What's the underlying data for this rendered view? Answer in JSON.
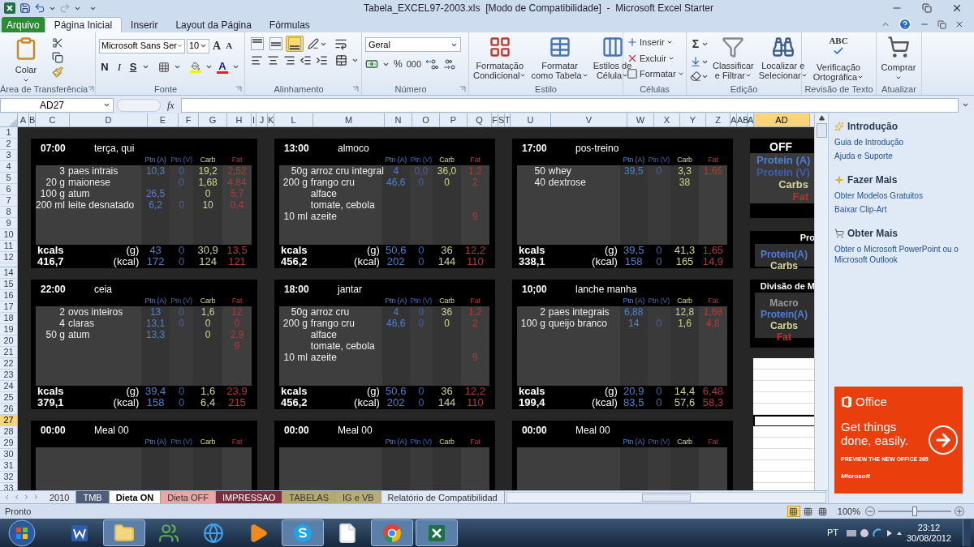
{
  "window": {
    "title": "Tabela_EXCEL97-2003.xls  [Modo de Compatibilidade]  -  Microsoft Excel Starter"
  },
  "ribbon_tabs": [
    {
      "label": "Arquivo",
      "kind": "file",
      "selected": false
    },
    {
      "label": "Página Inicial",
      "kind": "tab",
      "selected": true
    },
    {
      "label": "Inserir",
      "kind": "tab",
      "selected": false
    },
    {
      "label": "Layout da Página",
      "kind": "tab",
      "selected": false
    },
    {
      "label": "Fórmulas",
      "kind": "tab",
      "selected": false
    }
  ],
  "ribbon": {
    "clipboard": {
      "title": "Área de Transferência",
      "paste": "Colar"
    },
    "font": {
      "title": "Fonte",
      "font_name": "Microsoft Sans Ser",
      "font_size": "10",
      "grow": "A",
      "shrink": "A",
      "bold": "N",
      "italic": "I",
      "underline": "S",
      "color_letter": "A"
    },
    "alignment": {
      "title": "Alinhamento",
      "vertical": [
        {
          "selected": false
        },
        {
          "selected": false
        },
        {
          "selected": true
        }
      ]
    },
    "number": {
      "title": "Número",
      "format": "Geral",
      "percent": "%",
      "thousands": "000"
    },
    "styles": {
      "title": "Estilo",
      "buttons": [
        {
          "lines": [
            "Formatação",
            "Condicional"
          ]
        },
        {
          "lines": [
            "Formatar",
            "como Tabela"
          ]
        },
        {
          "lines": [
            "Estilos de",
            "Célula"
          ]
        }
      ]
    },
    "cells": {
      "title": "Células",
      "buttons": [
        "Inserir",
        "Excluir",
        "Formatar"
      ]
    },
    "editing": {
      "title": "Edição",
      "sum": "Σ",
      "buttons": [
        {
          "lines": [
            "Classificar",
            "e Filtrar"
          ]
        },
        {
          "lines": [
            "Localizar e",
            "Selecionar"
          ]
        }
      ]
    },
    "proofing": {
      "title": "Revisão de Texto",
      "icon_text": "ABC",
      "lines": [
        "Verificação",
        "Ortográfica"
      ]
    },
    "update": {
      "title": "Atualizar",
      "label": "Comprar"
    }
  },
  "formula_bar": {
    "name_box": "AD27",
    "fx": "fx"
  },
  "columns": [
    {
      "label": "A",
      "selected": false
    },
    {
      "label": "B",
      "selected": false
    },
    {
      "label": "C",
      "selected": false
    },
    {
      "label": "D",
      "selected": false
    },
    {
      "label": "E",
      "selected": false
    },
    {
      "label": "F",
      "selected": false
    },
    {
      "label": "G",
      "selected": false
    },
    {
      "label": "H",
      "selected": false
    },
    {
      "label": "I",
      "selected": false
    },
    {
      "label": "J",
      "selected": false
    },
    {
      "label": "K",
      "selected": false
    },
    {
      "label": "L",
      "selected": false
    },
    {
      "label": "M",
      "selected": false
    },
    {
      "label": "N",
      "selected": false
    },
    {
      "label": "O",
      "selected": false
    },
    {
      "label": "P",
      "selected": false
    },
    {
      "label": "Q",
      "selected": false
    },
    {
      "label": "F",
      "selected": false
    },
    {
      "label": "S",
      "selected": false
    },
    {
      "label": "T",
      "selected": false
    },
    {
      "label": "U",
      "selected": false
    },
    {
      "label": "V",
      "selected": false
    },
    {
      "label": "W",
      "selected": false
    },
    {
      "label": "X",
      "selected": false
    },
    {
      "label": "Y",
      "selected": false
    },
    {
      "label": "Z",
      "selected": false
    },
    {
      "label": "A",
      "selected": false
    },
    {
      "label": "AB",
      "selected": false
    },
    {
      "label": "A",
      "selected": false
    },
    {
      "label": "AD",
      "selected": true
    }
  ],
  "rows": [
    {
      "label": "1",
      "selected": false
    },
    {
      "label": "2",
      "selected": false
    },
    {
      "label": "3",
      "selected": false
    },
    {
      "label": "4",
      "selected": false
    },
    {
      "label": "5",
      "selected": false
    },
    {
      "label": "6",
      "selected": false
    },
    {
      "label": "7",
      "selected": false
    },
    {
      "label": "8",
      "selected": false
    },
    {
      "label": "9",
      "selected": false
    },
    {
      "label": "10",
      "selected": false
    },
    {
      "label": "11",
      "selected": false
    },
    {
      "label": "12",
      "selected": false
    },
    {
      "label": "14",
      "selected": false
    },
    {
      "label": "15",
      "selected": false
    },
    {
      "label": "16",
      "selected": false
    },
    {
      "label": "17",
      "selected": false
    },
    {
      "label": "18",
      "selected": false
    },
    {
      "label": "19",
      "selected": false
    },
    {
      "label": "20",
      "selected": false
    },
    {
      "label": "21",
      "selected": false
    },
    {
      "label": "22",
      "selected": false
    },
    {
      "label": "23",
      "selected": false
    },
    {
      "label": "24",
      "selected": false
    },
    {
      "label": "25",
      "selected": false
    },
    {
      "label": "26",
      "selected": false
    },
    {
      "label": "27",
      "selected": true
    },
    {
      "label": "28",
      "selected": false
    },
    {
      "label": "29",
      "selected": false
    },
    {
      "label": "30",
      "selected": false
    },
    {
      "label": "31",
      "selected": false
    },
    {
      "label": "32",
      "selected": false
    },
    {
      "label": "33",
      "selected": false
    }
  ],
  "meal_cards": [
    {
      "time": "07:00",
      "name": "terça, qui",
      "headers": [
        "Ptn (A)",
        "Ptn (V)",
        "Carb",
        "Fat"
      ],
      "items": [
        {
          "qty": "3",
          "name": "paes intrais",
          "ptn_a": "10,3",
          "ptn_v": "0",
          "carb": "19,2",
          "fat": "2,52"
        },
        {
          "qty": "20 g",
          "name": "maionese",
          "ptn_v": "0",
          "carb": "1,68",
          "fat": "4,84"
        },
        {
          "qty": "100 g",
          "name": "atum",
          "ptn_a": "26,5",
          "carb": "0",
          "fat": "5,7"
        },
        {
          "qty": "200 ml",
          "name": "leite desnatado",
          "ptn_a": "6,2",
          "ptn_v": "0",
          "carb": "10",
          "fat": "0,4"
        }
      ],
      "totals": {
        "label": "kcals",
        "unit_g": "(g)",
        "grams": [
          "43",
          "0",
          "30,9",
          "13,5"
        ],
        "kcal": "416,7",
        "unit_kcal": "(kcal)",
        "kcals": [
          "172",
          "0",
          "124",
          "121"
        ]
      }
    },
    {
      "time": "13:00",
      "name": "almoco",
      "headers": [
        "Ptn (A)",
        "Ptn (V)",
        "Carb",
        "Fat"
      ],
      "items": [
        {
          "qty": "50g",
          "name": "arroz cru integral",
          "ptn_a": "4",
          "ptn_v": "0,0",
          "carb": "36,0",
          "fat": "1,2"
        },
        {
          "qty": "200 g",
          "name": "frango cru",
          "ptn_a": "46,6",
          "ptn_v": "0",
          "carb": "0",
          "fat": "2"
        },
        {
          "name": "alface"
        },
        {
          "name": "tomate, cebola"
        },
        {
          "qty": "10 ml",
          "name": "azeite",
          "fat": "9"
        }
      ],
      "totals": {
        "label": "kcals",
        "unit_g": "(g)",
        "grams": [
          "50,6",
          "0",
          "36",
          "12,2"
        ],
        "kcal": "456,2",
        "unit_kcal": "(kcal)",
        "kcals": [
          "202",
          "0",
          "144",
          "110"
        ]
      }
    },
    {
      "time": "17:00",
      "name": "pos-treino",
      "headers": [
        "Ptn (A)",
        "Ptn (V)",
        "Carb",
        "Fat"
      ],
      "items": [
        {
          "qty": "50",
          "name": "whey",
          "ptn_a": "39,5",
          "ptn_v": "0",
          "carb": "3,3",
          "fat": "1,65"
        },
        {
          "qty": "40",
          "name": "dextrose",
          "carb": "38"
        }
      ],
      "totals": {
        "label": "kcals",
        "unit_g": "(g)",
        "grams": [
          "39,5",
          "0",
          "41,3",
          "1,65"
        ],
        "kcal": "338,1",
        "unit_kcal": "(kcal)",
        "kcals": [
          "158",
          "0",
          "165",
          "14,9"
        ]
      }
    },
    {
      "time": "22:00",
      "name": "ceia",
      "headers": [
        "Ptn (A)",
        "Ptn (V)",
        "Carb",
        "Fat"
      ],
      "items": [
        {
          "qty": "2",
          "name": "ovos inteiros",
          "ptn_a": "13",
          "ptn_v": "0",
          "carb": "1,6",
          "fat": "12"
        },
        {
          "qty": "4",
          "name": "claras",
          "ptn_a": "13,1",
          "ptn_v": "0",
          "carb": "0",
          "fat": "0"
        },
        {
          "qty": "50 g",
          "name": "atum",
          "ptn_a": "13,3",
          "carb": "0",
          "fat": "2,9"
        },
        {
          "fat": "9"
        }
      ],
      "totals": {
        "label": "kcals",
        "unit_g": "(g)",
        "grams": [
          "39,4",
          "0",
          "1,6",
          "23,9"
        ],
        "kcal": "379,1",
        "unit_kcal": "(kcal)",
        "kcals": [
          "158",
          "0",
          "6,4",
          "215"
        ]
      }
    },
    {
      "time": "18:00",
      "name": "jantar",
      "headers": [
        "Ptn (A)",
        "Ptn (V)",
        "Carb",
        "Fat"
      ],
      "items": [
        {
          "qty": "50g",
          "name": "arroz cru",
          "ptn_a": "4",
          "ptn_v": "0",
          "carb": "36",
          "fat": "1,2"
        },
        {
          "qty": "200 g",
          "name": "frango cru",
          "ptn_a": "46,6",
          "ptn_v": "0",
          "carb": "0",
          "fat": "2"
        },
        {
          "name": "alface"
        },
        {
          "name": "tomate, cebola"
        },
        {
          "qty": "10 ml",
          "name": "azeite",
          "fat": "9"
        }
      ],
      "totals": {
        "label": "kcals",
        "unit_g": "(g)",
        "grams": [
          "50,6",
          "0",
          "36",
          "12,2"
        ],
        "kcal": "456,2",
        "unit_kcal": "(kcal)",
        "kcals": [
          "202",
          "0",
          "144",
          "110"
        ]
      }
    },
    {
      "time": "10;00",
      "name": "lanche manha",
      "headers": [
        "Ptn (A)",
        "Ptn (V)",
        "Carb",
        "Fat"
      ],
      "items": [
        {
          "qty": "2",
          "name": "paes integrais",
          "ptn_a": "6,88",
          "carb": "12,8",
          "fat": "1,68"
        },
        {
          "qty": "100 g",
          "name": "queijo branco",
          "ptn_a": "14",
          "ptn_v": "0",
          "carb": "1,6",
          "fat": "4,8"
        }
      ],
      "totals": {
        "label": "kcals",
        "unit_g": "(g)",
        "grams": [
          "20,9",
          "0",
          "14,4",
          "6,48"
        ],
        "kcal": "199,4",
        "unit_kcal": "(kcal)",
        "kcals": [
          "83,5",
          "0",
          "57,6",
          "58,3"
        ]
      }
    },
    {
      "time": "00:00",
      "name": "Meal 00",
      "headers": [
        "Ptn (A)",
        "Ptn (V)",
        "Carb",
        "Fat"
      ]
    },
    {
      "time": "00:00",
      "name": "Meal 00",
      "headers": [
        "Ptn (A)",
        "Ptn (V)",
        "Carb",
        "Fat"
      ]
    },
    {
      "time": "00:00",
      "name": "Meal 00",
      "headers": [
        "Ptn (A)",
        "Ptn (V)",
        "Carb",
        "Fat"
      ]
    }
  ],
  "side_panels": [
    {
      "kind": "summary",
      "title": "OFF",
      "lines": [
        {
          "text": "Protein (A)",
          "color": "#4f7fd6"
        },
        {
          "text": "Protein (V)",
          "color": "#3f5fae"
        },
        {
          "text": "Carbs",
          "color": "#d2d69a"
        },
        {
          "text": "Fat",
          "color": "#c0302a"
        }
      ]
    },
    {
      "kind": "table",
      "title": "Pro",
      "lines": [
        {
          "text": "Protein(A)",
          "color": "#4f7fd6"
        },
        {
          "text": "Carbs",
          "color": "#d2d69a"
        }
      ]
    },
    {
      "kind": "table",
      "title": "Divisão de M",
      "lines": [
        {
          "text": "Macro",
          "color": "#9a9a9a"
        },
        {
          "text": "Protein(A)",
          "color": "#4f7fd6"
        },
        {
          "text": "Carbs",
          "color": "#d2d69a"
        },
        {
          "text": "Fat",
          "color": "#c0302a"
        }
      ]
    }
  ],
  "sheet_tabs": [
    {
      "label": "2010",
      "selected": false
    },
    {
      "label": "TMB",
      "color": "#4e5d79",
      "selected": false
    },
    {
      "label": "Dieta ON",
      "selected": true
    },
    {
      "label": "Dieta OFF",
      "color": "#e8a7a5",
      "selected": false
    },
    {
      "label": "IMPRESSAO",
      "color": "#7b2f3a",
      "selected": false
    },
    {
      "label": "TABELAS",
      "color": "#b3a96e",
      "selected": false
    },
    {
      "label": "IG e VB",
      "color": "#b8ad78",
      "selected": false
    },
    {
      "label": "Relatório de Compatibilidad",
      "selected": false
    }
  ],
  "task_pane": {
    "sections": [
      {
        "kind": "intro",
        "title": "Introdução",
        "links": [
          "Guia de Introdução",
          "Ajuda e Suporte"
        ]
      },
      {
        "kind": "more",
        "title": "Fazer Mais",
        "links": [
          "Obter Modelos Gratuitos",
          "Baixar Clip-Art"
        ]
      },
      {
        "kind": "get",
        "title": "Obter Mais",
        "links": [
          "Obter o Microsoft PowerPoint ou o Microsoft Outlook"
        ]
      }
    ],
    "ad": {
      "brand": "Office",
      "headline": "Get things done, easily.",
      "cta": "PREVIEW THE NEW OFFICE 365",
      "company": "Microsoft"
    }
  },
  "status_bar": {
    "text": "Pronto",
    "views": [
      {
        "selected": true
      },
      {
        "selected": false
      },
      {
        "selected": false
      }
    ],
    "zoom": "100%",
    "zoom_slider": {
      "level": 0.5
    }
  },
  "taskbar": {
    "apps": [
      {
        "kind": "word",
        "active": false
      },
      {
        "kind": "folder",
        "active": true
      },
      {
        "kind": "messenger",
        "active": false
      },
      {
        "kind": "browser",
        "active": false
      },
      {
        "kind": "media",
        "active": false
      },
      {
        "kind": "skype",
        "active": true
      },
      {
        "kind": "document",
        "active": false
      },
      {
        "kind": "chrome",
        "active": true
      },
      {
        "kind": "excel",
        "active": true
      }
    ],
    "language": "PT",
    "time": "23:12",
    "date": "30/08/2012"
  }
}
